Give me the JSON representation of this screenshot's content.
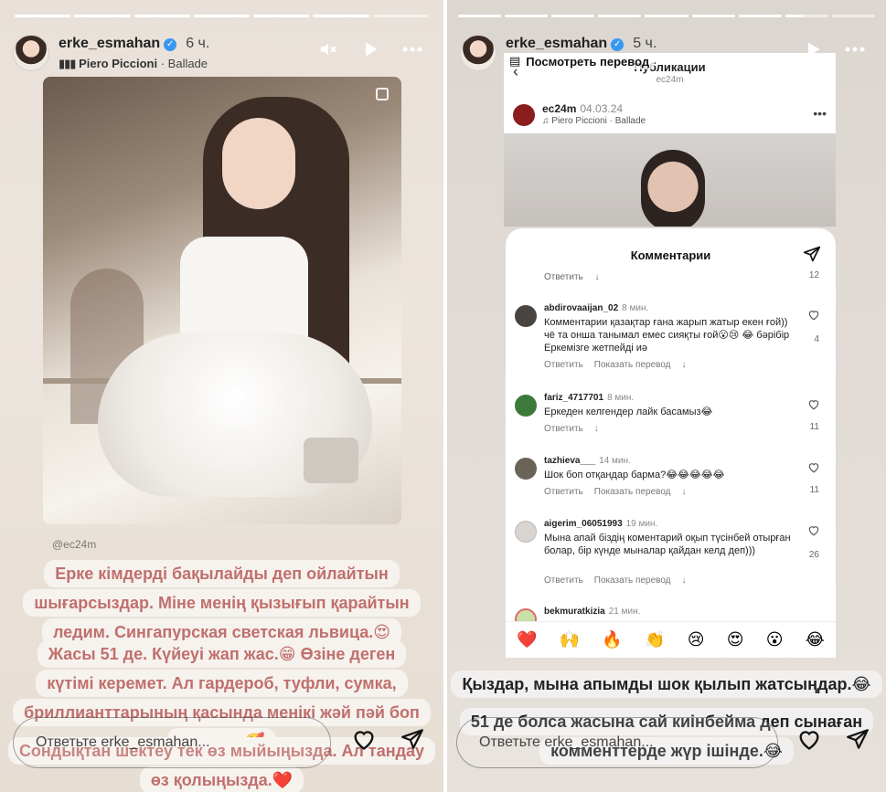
{
  "left": {
    "username": "erke_esmahan",
    "time": "6 ч.",
    "music": {
      "artist": "Piero Piccioni",
      "separator": "·",
      "track": "Ballade"
    },
    "mention": "@ec24m",
    "caption_block1": [
      "Ерке кімдерді бақылайды деп ойлайтын",
      "шығарсыздар. Міне менің қызығып қарайтын",
      "ледим. Сингапурская светская львица.😍"
    ],
    "caption_block2": [
      "Жасы 51 де. Күйеуі жап жас.😁 Өзіне деген",
      "күтімі керемет. Ал гардероб, туфли, сумка,",
      "бриллианттарының қасында менікі жәй пәй боп",
      "қалады.🥰"
    ],
    "caption_block3": [
      "Сондықтан шектеу тек өз мыйыңызда. Ал тандау",
      "өз қолыңызда.❤️"
    ],
    "reply_placeholder": "Ответьте erke_esmahan..."
  },
  "right": {
    "username": "erke_esmahan",
    "time": "5 ч.",
    "translate_label": "Посмотреть перевод",
    "inner_title": "Публикации",
    "inner_sub": "ec24m",
    "post_user": "ec24m",
    "post_date": "04.03.24",
    "post_music": "♫ Piero Piccioni · Ballade",
    "sheet_title": "Комментарии",
    "top_reply": "Ответить",
    "top_count": "12",
    "comments": [
      {
        "user": "abdirovaaijan_02",
        "time": "8 мин.",
        "text": "Комментарии қазақтар ғана жарып жатыр екен ғой)) чё та онша танымал емес сияқты ғой😮😢 😂 бәрібір Еркемізге жетпейді иә",
        "reply": "Ответить",
        "translate": "Показать перевод",
        "likes": "4"
      },
      {
        "user": "fariz_4717701",
        "time": "8 мин.",
        "text": "Еркеден келгендер лайк басамыз😂",
        "reply": "Ответить",
        "translate": "",
        "likes": "11"
      },
      {
        "user": "tazhieva___",
        "time": "14 мин.",
        "text": "Шок боп отқандар барма?😂😂😂😂😂",
        "reply": "Ответить",
        "translate": "Показать перевод",
        "likes": "11"
      },
      {
        "user": "aigerim_06051993",
        "time": "19 мин.",
        "text": "Мына апай біздің коментарий оқып түсінбей отырған болар, бір күнде мыналар қайдан келд деп)))",
        "reply": "Ответить",
        "translate": "Показать перевод",
        "likes": "26"
      },
      {
        "user": "bekmuratkizia",
        "time": "21 мин.",
        "text": "",
        "reply": "",
        "translate": "",
        "likes": ""
      }
    ],
    "emoji_bar": [
      "❤️",
      "🙌",
      "🔥",
      "👏",
      "😢",
      "😍",
      "😮",
      "😂"
    ],
    "caption_block1": [
      "Қыздар, мына апымды шок қылып жатсыңдар.😂"
    ],
    "caption_block2": [
      "51 де болса жасына сай киінбейма деп сынаған",
      "комменттерде жүр ішінде.😂"
    ],
    "reply_placeholder": "Ответьте erke_esmahan..."
  }
}
